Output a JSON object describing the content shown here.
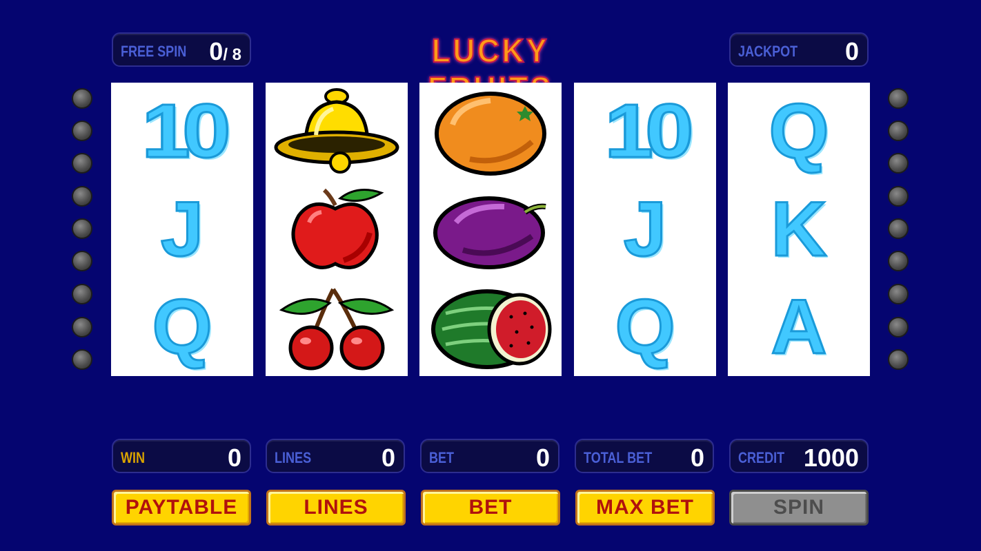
{
  "title": "LUCKY FRUITS",
  "top_panels": {
    "free_spin": {
      "label": "FREE SPIN",
      "value": "0",
      "total": "/ 8"
    },
    "jackpot": {
      "label": "JACKPOT",
      "value": "0"
    }
  },
  "reels": [
    [
      "10",
      "J",
      "Q"
    ],
    [
      "bell-icon",
      "apple-icon",
      "cherry-icon"
    ],
    [
      "orange-icon",
      "plum-icon",
      "watermelon-icon"
    ],
    [
      "10",
      "J",
      "Q"
    ],
    [
      "Q",
      "K",
      "A"
    ]
  ],
  "stats": {
    "win": {
      "label": "WIN",
      "value": "0"
    },
    "lines": {
      "label": "LINES",
      "value": "0"
    },
    "bet": {
      "label": "BET",
      "value": "0"
    },
    "total_bet": {
      "label": "TOTAL BET",
      "value": "0"
    },
    "credit": {
      "label": "CREDIT",
      "value": "1000"
    }
  },
  "buttons": {
    "paytable": "PAYTABLE",
    "lines": "LINES",
    "bet": "BET",
    "max_bet": "MAX BET",
    "spin": "SPIN"
  },
  "colors": {
    "background": "#050570",
    "reel_letter": "#41c8ff",
    "button_yellow": "#ffd400",
    "button_disabled": "#8f8f8f",
    "win_label": "#d9a300"
  }
}
